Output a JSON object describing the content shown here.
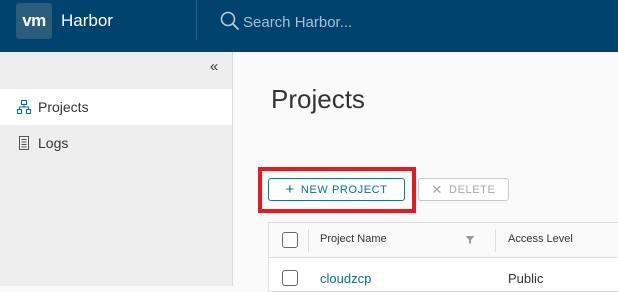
{
  "header": {
    "logo_text": "vm",
    "brand": "Harbor",
    "search_placeholder": "Search Harbor..."
  },
  "sidebar": {
    "items": [
      {
        "label": "Projects",
        "active": true
      },
      {
        "label": "Logs",
        "active": false
      }
    ]
  },
  "main": {
    "title": "Projects",
    "new_project_label": "NEW PROJECT",
    "delete_label": "DELETE",
    "table": {
      "columns": [
        "Project Name",
        "Access Level"
      ],
      "rows": [
        {
          "name": "cloudzcp",
          "access": "Public"
        }
      ]
    }
  },
  "colors": {
    "header_bg": "#00436e",
    "primary": "#0072a3",
    "highlight": "#e31b23"
  }
}
